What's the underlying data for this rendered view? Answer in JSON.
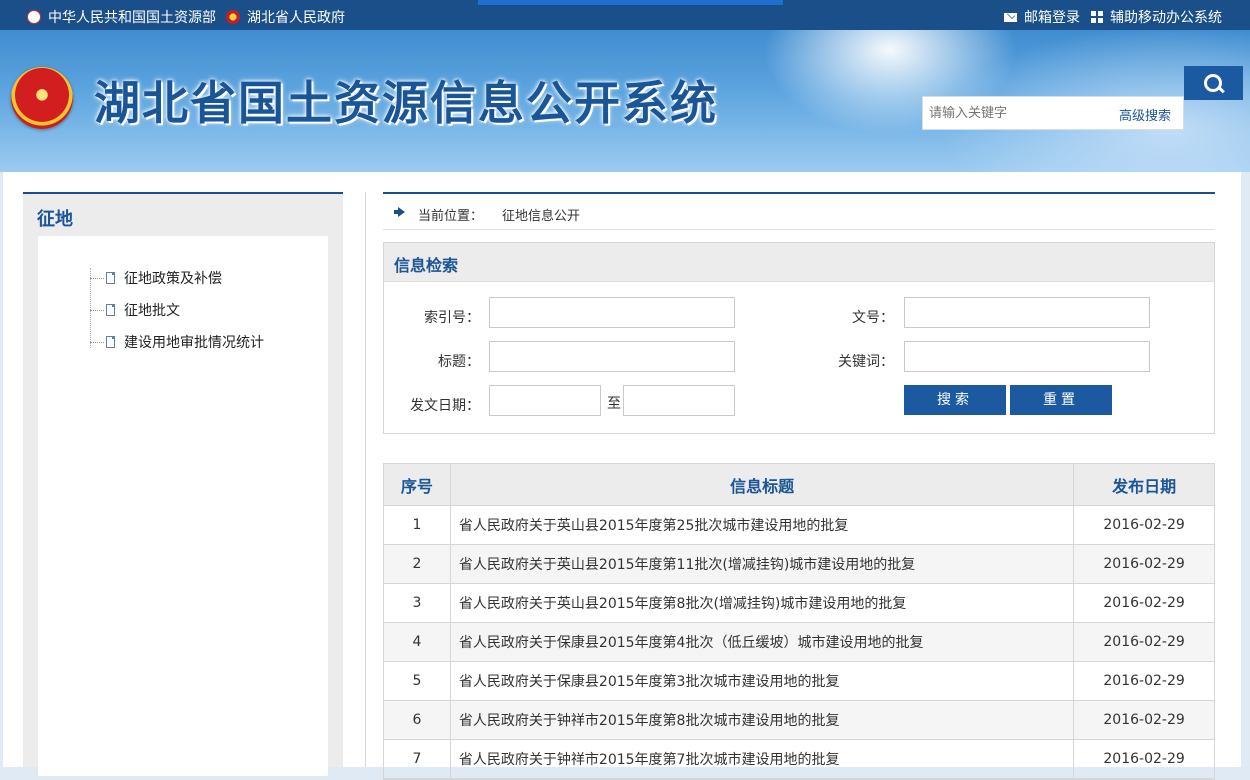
{
  "topbar": {
    "link_mlr": "中华人民共和国国土资源部",
    "link_gov": "湖北省人民政府",
    "mail_login": "邮箱登录",
    "mobile_office": "辅助移动办公系统"
  },
  "header": {
    "site_title": "湖北省国土资源信息公开系统",
    "search_placeholder": "请输入关键字",
    "advanced_search": "高级搜索"
  },
  "sidebar": {
    "title": "征地",
    "items": [
      {
        "label": "征地政策及补偿"
      },
      {
        "label": "征地批文"
      },
      {
        "label": "建设用地审批情况统计"
      }
    ]
  },
  "breadcrumb": {
    "label": "当前位置：",
    "current": "征地信息公开"
  },
  "search_form": {
    "title": "信息检索",
    "index_label": "索引号：",
    "doc_no_label": "文号：",
    "title_label": "标题：",
    "keyword_label": "关键词：",
    "date_label": "发文日期：",
    "to_label": "至",
    "search_button": "搜索",
    "reset_button": "重置"
  },
  "table": {
    "headers": [
      "序号",
      "信息标题",
      "发布日期"
    ],
    "rows": [
      {
        "no": "1",
        "title": "省人民政府关于英山县2015年度第25批次城市建设用地的批复",
        "date": "2016-02-29"
      },
      {
        "no": "2",
        "title": "省人民政府关于英山县2015年度第11批次(增减挂钩)城市建设用地的批复",
        "date": "2016-02-29"
      },
      {
        "no": "3",
        "title": "省人民政府关于英山县2015年度第8批次(增减挂钩)城市建设用地的批复",
        "date": "2016-02-29"
      },
      {
        "no": "4",
        "title": "省人民政府关于保康县2015年度第4批次（低丘缓坡）城市建设用地的批复",
        "date": "2016-02-29"
      },
      {
        "no": "5",
        "title": "省人民政府关于保康县2015年度第3批次城市建设用地的批复",
        "date": "2016-02-29"
      },
      {
        "no": "6",
        "title": "省人民政府关于钟祥市2015年度第8批次城市建设用地的批复",
        "date": "2016-02-29"
      },
      {
        "no": "7",
        "title": "省人民政府关于钟祥市2015年度第7批次城市建设用地的批复",
        "date": "2016-02-29"
      }
    ]
  }
}
